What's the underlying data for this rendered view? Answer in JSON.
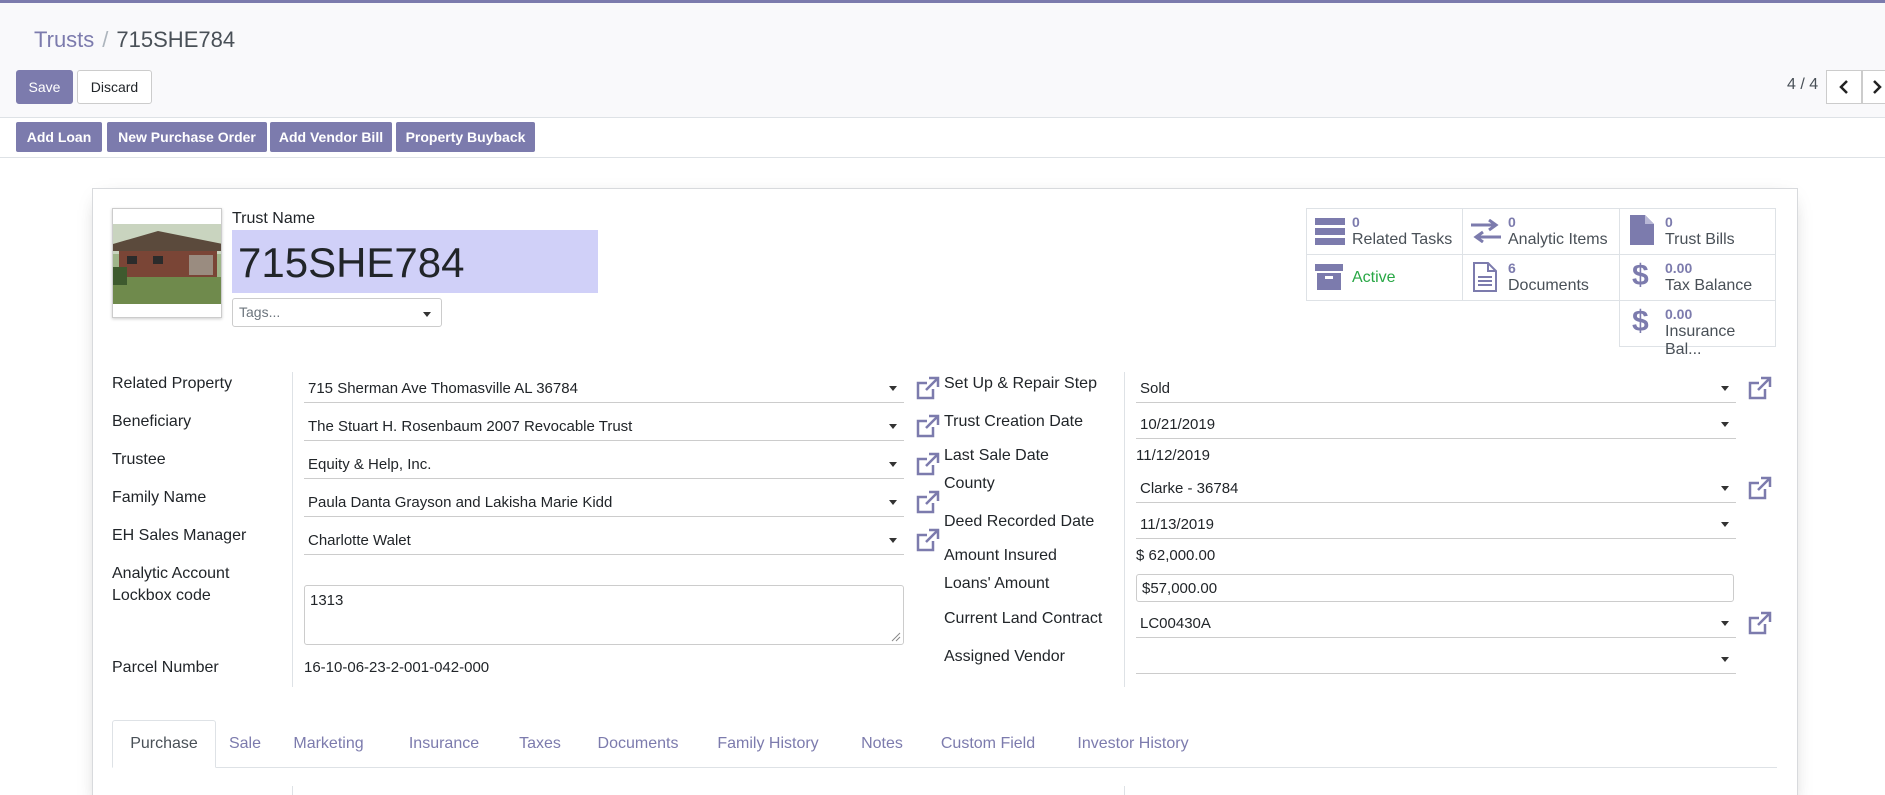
{
  "breadcrumb": {
    "parent": "Trusts",
    "separator": "/",
    "current": "715SHE784"
  },
  "actions": {
    "save": "Save",
    "discard": "Discard"
  },
  "pager": {
    "value": "4 / 4"
  },
  "header_buttons": [
    "Add Loan",
    "New Purchase Order",
    "Add Vendor Bill",
    "Property Buyback"
  ],
  "trust": {
    "name_label": "Trust Name",
    "name": "715SHE784",
    "tags_placeholder": "Tags..."
  },
  "smart_buttons": [
    {
      "value": "0",
      "label": "Related Tasks",
      "icon": "tasks-icon"
    },
    {
      "value": "0",
      "label": "Analytic Items",
      "icon": "exchange-icon"
    },
    {
      "value": "0",
      "label": "Trust Bills",
      "icon": "file-icon"
    },
    {
      "value": "",
      "label": "Active",
      "icon": "archive-icon"
    },
    {
      "value": "6",
      "label": "Documents",
      "icon": "document-icon"
    },
    {
      "value": "0.00",
      "label": "Tax Balance",
      "icon": "dollar-icon"
    },
    {
      "value": "0.00",
      "label": "Insurance Bal...",
      "icon": "dollar-icon"
    }
  ],
  "left_fields": {
    "related_property": {
      "label": "Related Property",
      "value": "715 Sherman Ave Thomasville AL 36784"
    },
    "beneficiary": {
      "label": "Beneficiary",
      "value": "The Stuart H. Rosenbaum 2007 Revocable Trust"
    },
    "trustee": {
      "label": "Trustee",
      "value": "Equity & Help, Inc."
    },
    "family_name": {
      "label": "Family Name",
      "value": "Paula Danta Grayson and Lakisha Marie Kidd"
    },
    "sales_manager": {
      "label": "EH Sales Manager",
      "value": "Charlotte Walet"
    },
    "analytic_account": {
      "label": "Analytic Account"
    },
    "lockbox": {
      "label": "Lockbox code",
      "value": "1313"
    },
    "parcel": {
      "label": "Parcel Number",
      "value": "16-10-06-23-2-001-042-000"
    }
  },
  "right_fields": {
    "repair_step": {
      "label": "Set Up & Repair Step",
      "value": "Sold"
    },
    "creation_date": {
      "label": "Trust Creation Date",
      "value": "10/21/2019"
    },
    "last_sale": {
      "label": "Last Sale Date",
      "value": "11/12/2019"
    },
    "county": {
      "label": "County",
      "value": "Clarke - 36784"
    },
    "deed_date": {
      "label": "Deed Recorded Date",
      "value": "11/13/2019"
    },
    "amount_insured": {
      "label": "Amount Insured",
      "value": "$ 62,000.00"
    },
    "loans_amount": {
      "label": "Loans' Amount",
      "value": "$57,000.00"
    },
    "land_contract": {
      "label": "Current Land Contract",
      "value": "LC00430A"
    },
    "vendor": {
      "label": "Assigned Vendor",
      "value": ""
    }
  },
  "tabs": [
    "Purchase",
    "Sale",
    "Marketing",
    "Insurance",
    "Taxes",
    "Documents",
    "Family History",
    "Notes",
    "Custom Field",
    "Investor History"
  ],
  "colors": {
    "accent": "#7c7bad",
    "active_status": "#28a745"
  }
}
